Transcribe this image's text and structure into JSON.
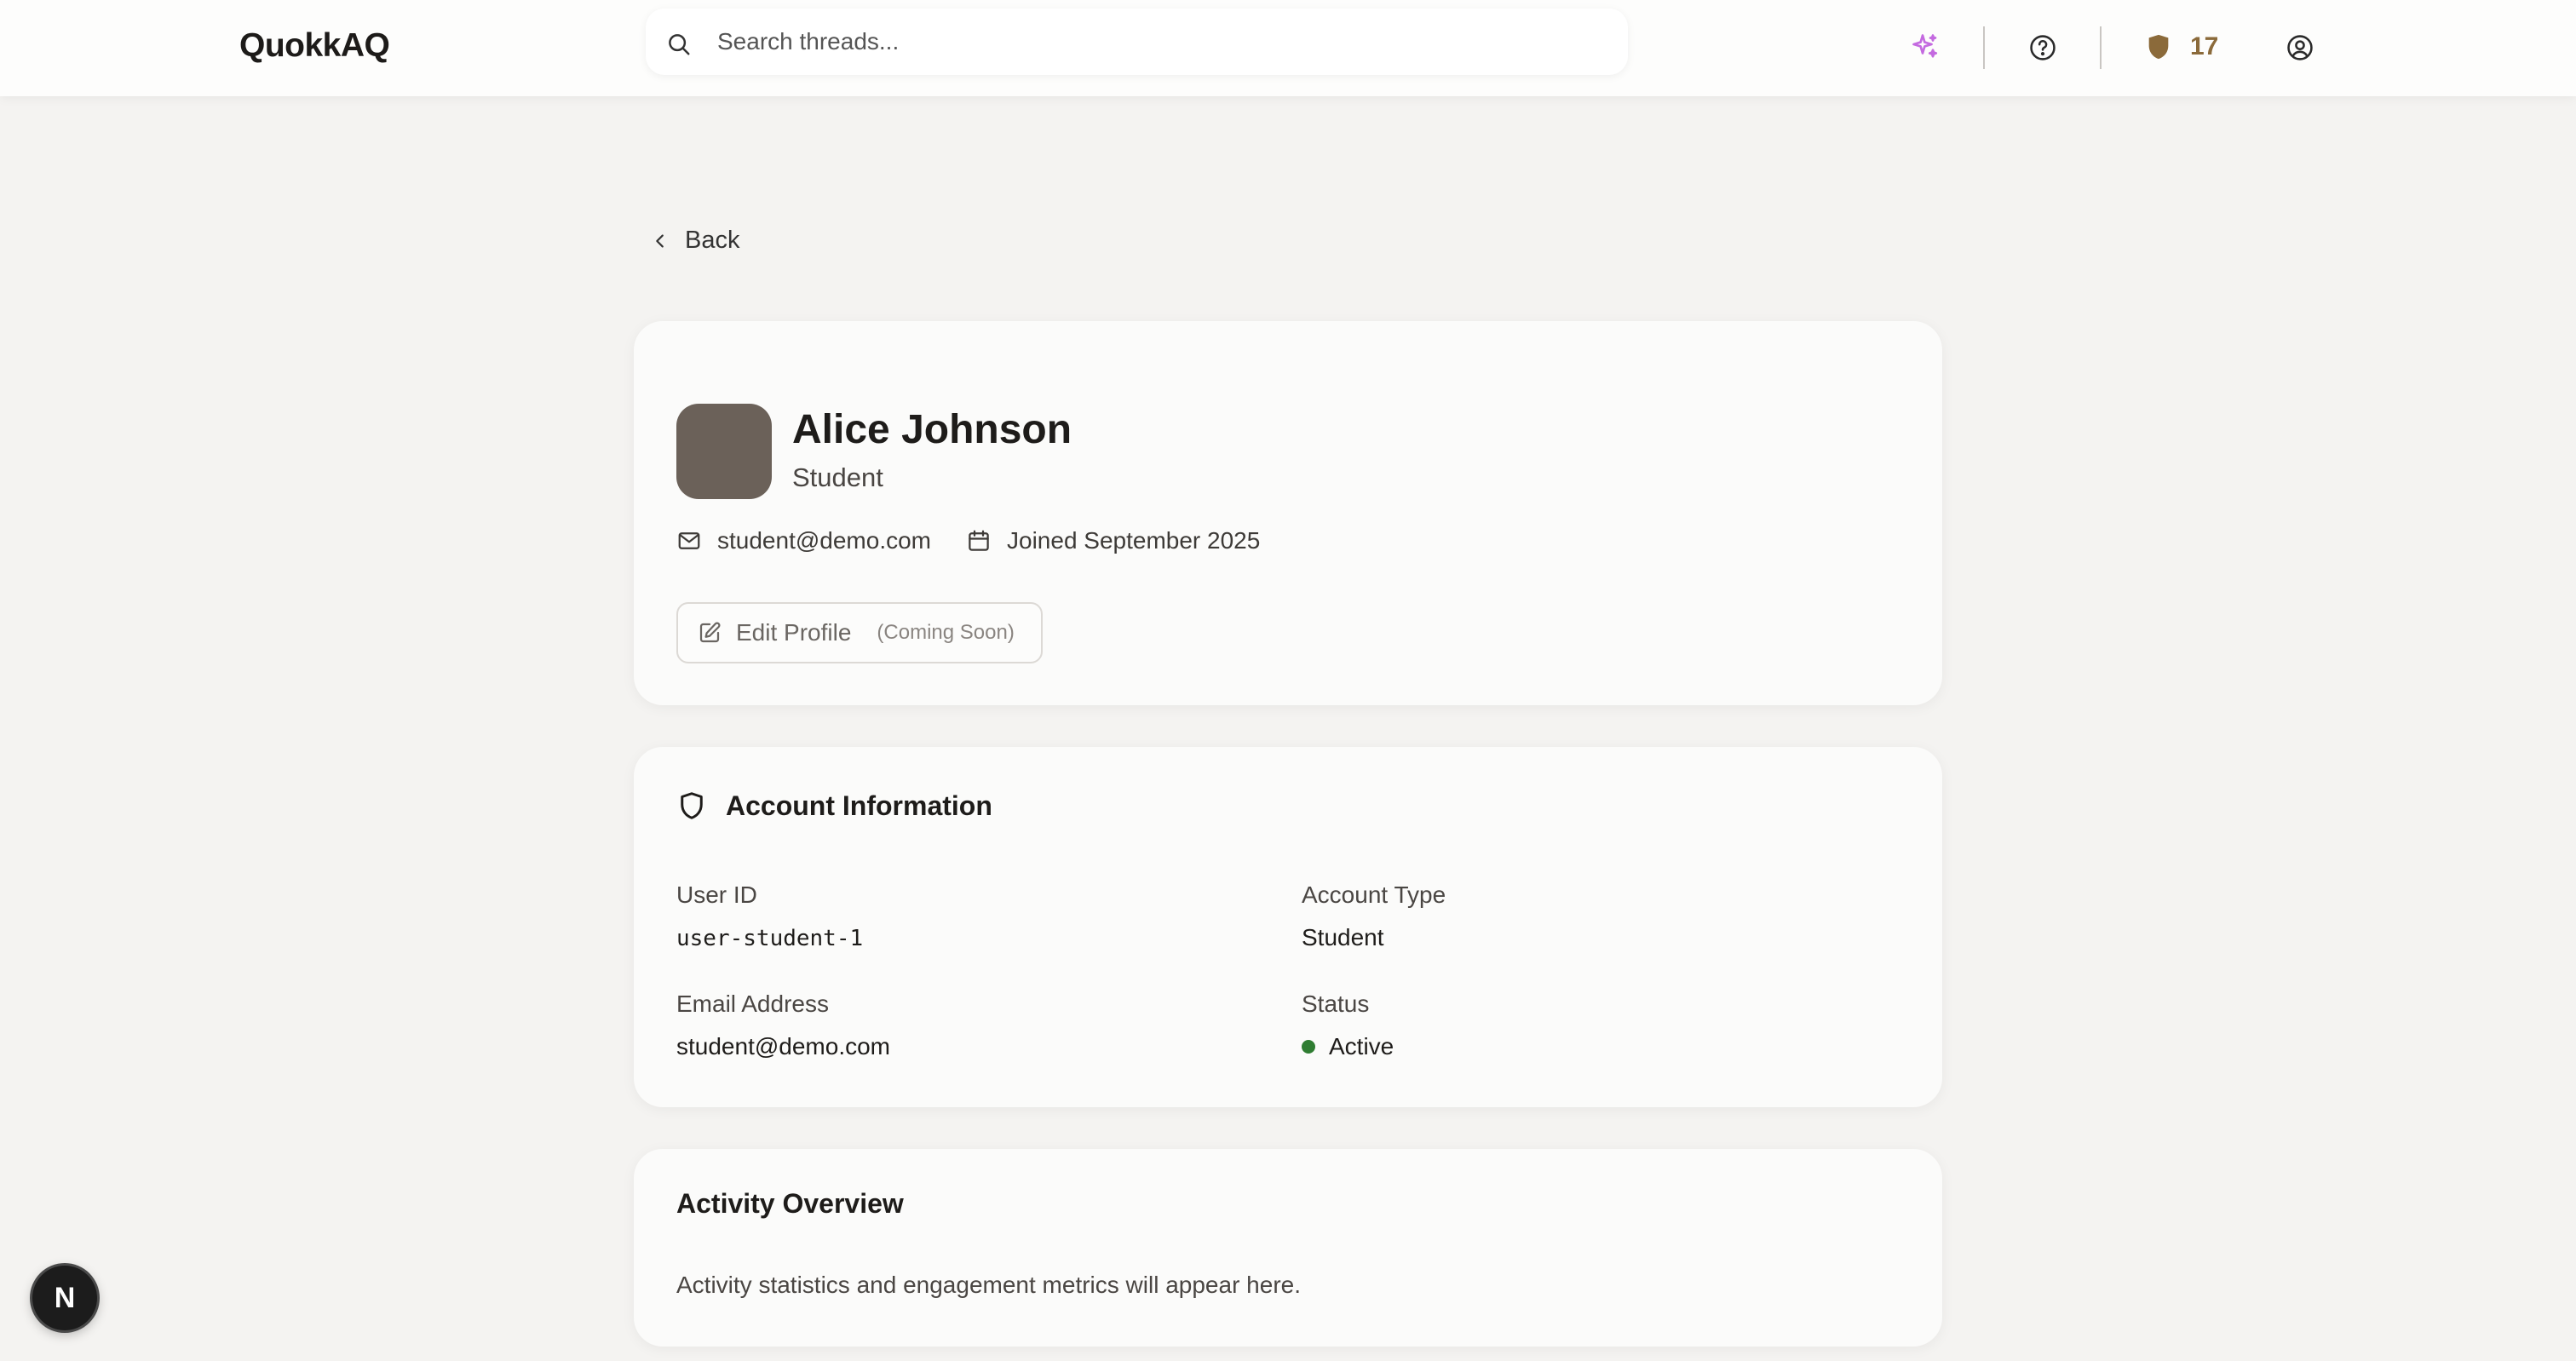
{
  "app": {
    "logo": "QuokkAQ"
  },
  "header": {
    "search_placeholder": "Search threads...",
    "points": "17",
    "icons": [
      "sparkles-icon",
      "help-circle-icon",
      "shield-badge-icon",
      "user-circle-icon"
    ],
    "accent_color": "#c46ae0",
    "points_color": "#8b6a3a"
  },
  "nav": {
    "back_label": "Back"
  },
  "profile": {
    "name": "Alice Johnson",
    "role": "Student",
    "email": "student@demo.com",
    "joined": "Joined September 2025",
    "edit_label": "Edit Profile",
    "edit_note": "(Coming Soon)"
  },
  "account": {
    "title": "Account Information",
    "user_id_label": "User ID",
    "user_id": "user-student-1",
    "account_type_label": "Account Type",
    "account_type": "Student",
    "email_label": "Email Address",
    "email": "student@demo.com",
    "status_label": "Status",
    "status": "Active",
    "status_color": "#2f7d32"
  },
  "activity": {
    "title": "Activity Overview",
    "text": "Activity statistics and engagement metrics will appear here."
  },
  "dev_badge": {
    "label": "N"
  }
}
